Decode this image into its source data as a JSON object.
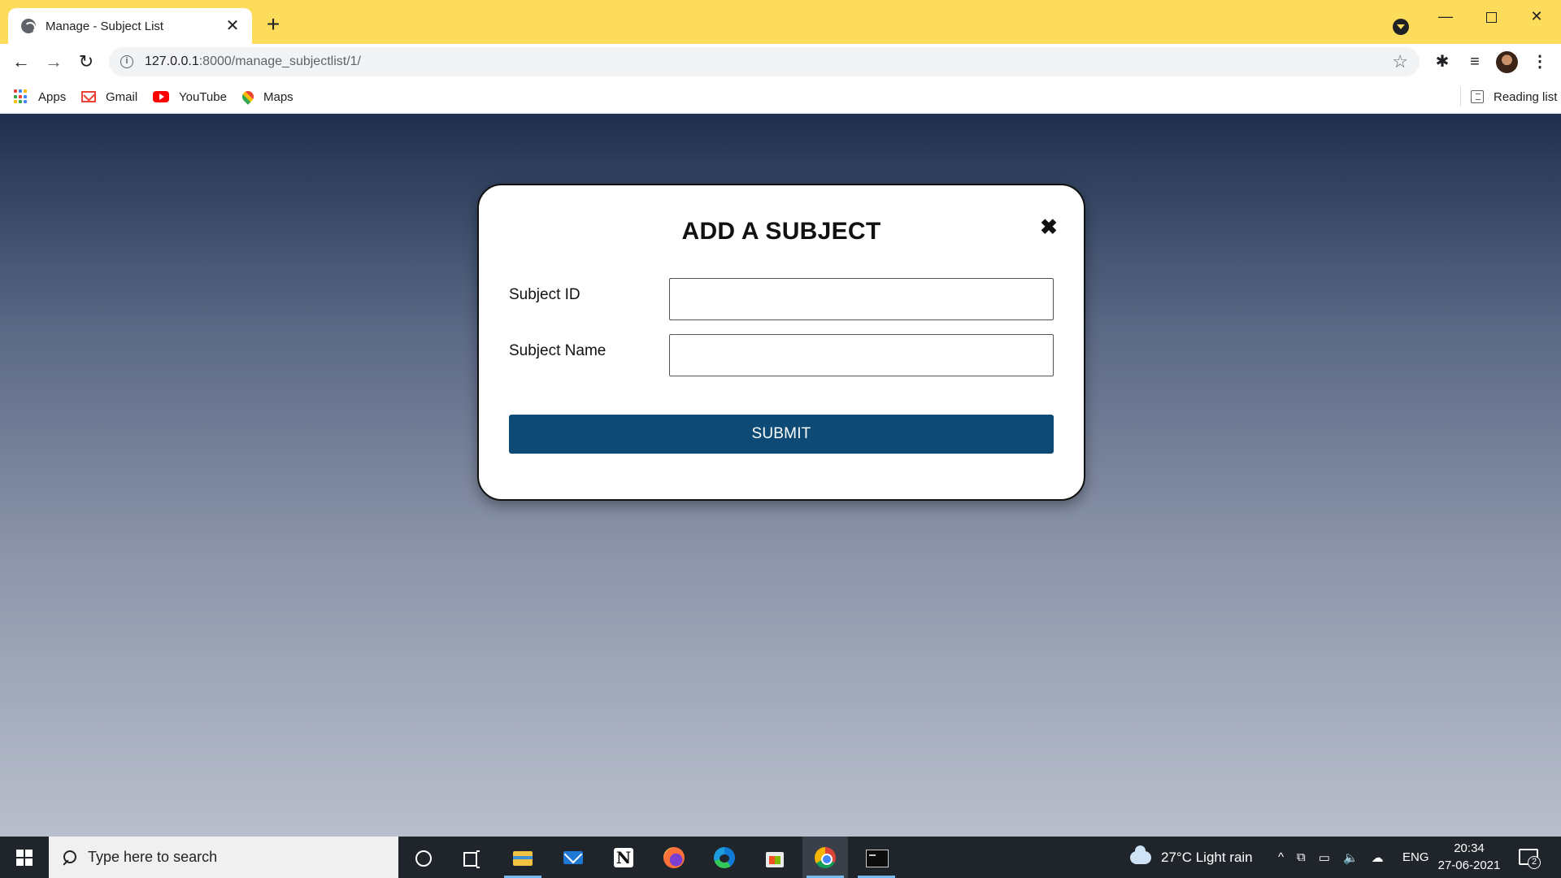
{
  "browser": {
    "tab": {
      "title": "Manage - Subject List",
      "close_glyph": "✕",
      "favicon": "globe-icon"
    },
    "new_tab_glyph": "+",
    "window_controls": {
      "minimize": "—",
      "close": "✕"
    },
    "nav": {
      "back": "←",
      "forward": "→",
      "reload": "↻"
    },
    "address": {
      "host": "127.0.0.1",
      "rest": ":8000/manage_subjectlist/1/"
    },
    "star_glyph": "☆",
    "extensions_glyph": "✱",
    "media_glyph": "≡",
    "menu_glyph": "⋮",
    "accent_color": "#fddc5c"
  },
  "bookmarks": {
    "items": [
      {
        "label": "Apps",
        "icon": "apps-grid-icon"
      },
      {
        "label": "Gmail",
        "icon": "gmail-icon"
      },
      {
        "label": "YouTube",
        "icon": "youtube-icon"
      },
      {
        "label": "Maps",
        "icon": "maps-icon"
      }
    ],
    "reading_list": "Reading list"
  },
  "modal": {
    "title": "ADD A SUBJECT",
    "close_glyph": "✖",
    "fields": [
      {
        "label": "Subject ID",
        "value": ""
      },
      {
        "label": "Subject Name",
        "value": ""
      }
    ],
    "submit_label": "SUBMIT",
    "button_color": "#0d4a75"
  },
  "taskbar": {
    "search_placeholder": "Type here to search",
    "notion_glyph": "N",
    "weather": "27°C  Light rain",
    "tray_glyphs": [
      "^",
      "⧉",
      "▭",
      "🔈",
      "☁"
    ],
    "language": "ENG",
    "time": "20:34",
    "date": "27-06-2021",
    "notification_count": "2"
  }
}
